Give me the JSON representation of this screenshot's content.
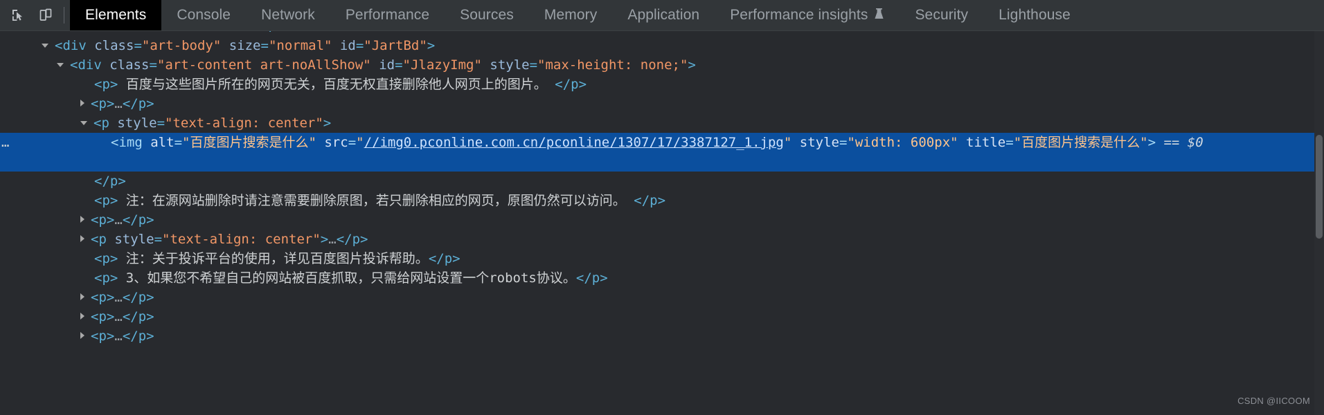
{
  "toolbar": {
    "inspect_icon": "inspect-cursor-icon",
    "device_icon": "device-toolbar-icon",
    "tabs": [
      {
        "label": "Elements",
        "active": true
      },
      {
        "label": "Console",
        "active": false
      },
      {
        "label": "Network",
        "active": false
      },
      {
        "label": "Performance",
        "active": false
      },
      {
        "label": "Sources",
        "active": false
      },
      {
        "label": "Memory",
        "active": false
      },
      {
        "label": "Application",
        "active": false
      },
      {
        "label": "Performance insights",
        "active": false,
        "badge_icon": "flask-icon"
      },
      {
        "label": "Security",
        "active": false
      },
      {
        "label": "Lighthouse",
        "active": false
      }
    ]
  },
  "dom": {
    "clipped_top_row": {
      "text": "<div class=\"art-info\" …></div>"
    },
    "rows": [
      {
        "id": "row-art-body",
        "indent": 80,
        "toggle": "open",
        "parts": [
          {
            "t": "pk",
            "s": "<"
          },
          {
            "t": "tag",
            "s": "div"
          },
          {
            "t": "sp",
            "s": " "
          },
          {
            "t": "att",
            "s": "class"
          },
          {
            "t": "pk",
            "s": "="
          },
          {
            "t": "val",
            "s": "\"art-body\""
          },
          {
            "t": "sp",
            "s": " "
          },
          {
            "t": "att",
            "s": "size"
          },
          {
            "t": "pk",
            "s": "="
          },
          {
            "t": "val",
            "s": "\"normal\""
          },
          {
            "t": "sp",
            "s": " "
          },
          {
            "t": "att",
            "s": "id"
          },
          {
            "t": "pk",
            "s": "="
          },
          {
            "t": "val",
            "s": "\"JartBd\""
          },
          {
            "t": "pk",
            "s": ">"
          }
        ]
      },
      {
        "id": "row-art-content",
        "indent": 102,
        "toggle": "open",
        "parts": [
          {
            "t": "pk",
            "s": "<"
          },
          {
            "t": "tag",
            "s": "div"
          },
          {
            "t": "sp",
            "s": " "
          },
          {
            "t": "att",
            "s": "class"
          },
          {
            "t": "pk",
            "s": "="
          },
          {
            "t": "val",
            "s": "\"art-content art-noAllShow\""
          },
          {
            "t": "sp",
            "s": " "
          },
          {
            "t": "att",
            "s": "id"
          },
          {
            "t": "pk",
            "s": "="
          },
          {
            "t": "val",
            "s": "\"JlazyImg\""
          },
          {
            "t": "sp",
            "s": " "
          },
          {
            "t": "att",
            "s": "style"
          },
          {
            "t": "pk",
            "s": "="
          },
          {
            "t": "val",
            "s": "\"max-height: none;\""
          },
          {
            "t": "pk",
            "s": ">"
          }
        ]
      },
      {
        "id": "row-p-1",
        "indent": 136,
        "toggle": "none",
        "parts": [
          {
            "t": "pk",
            "s": "<"
          },
          {
            "t": "tag",
            "s": "p"
          },
          {
            "t": "pk",
            "s": ">"
          },
          {
            "t": "txt",
            "s": " 百度与这些图片所在的网页无关，百度无权直接删除他人网页上的图片。 "
          },
          {
            "t": "pk",
            "s": "</"
          },
          {
            "t": "tag",
            "s": "p"
          },
          {
            "t": "pk",
            "s": ">"
          }
        ]
      },
      {
        "id": "row-p-2",
        "indent": 136,
        "toggle": "closed",
        "parts": [
          {
            "t": "pk",
            "s": "<"
          },
          {
            "t": "tag",
            "s": "p"
          },
          {
            "t": "pk",
            "s": ">"
          },
          {
            "t": "ellip",
            "s": "…"
          },
          {
            "t": "pk",
            "s": "</"
          },
          {
            "t": "tag",
            "s": "p"
          },
          {
            "t": "pk",
            "s": ">"
          }
        ]
      },
      {
        "id": "row-p-center-open",
        "indent": 136,
        "toggle": "open",
        "parts": [
          {
            "t": "pk",
            "s": "<"
          },
          {
            "t": "tag",
            "s": "p"
          },
          {
            "t": "sp",
            "s": " "
          },
          {
            "t": "att",
            "s": "style"
          },
          {
            "t": "pk",
            "s": "="
          },
          {
            "t": "val",
            "s": "\"text-align: center\""
          },
          {
            "t": "pk",
            "s": ">"
          }
        ]
      },
      {
        "id": "row-img-selected",
        "indent": 160,
        "toggle": "none",
        "selected": true,
        "wrapped": true,
        "gutter": "…",
        "parts": [
          {
            "t": "pk",
            "s": "<"
          },
          {
            "t": "tag",
            "s": "img"
          },
          {
            "t": "sp",
            "s": " "
          },
          {
            "t": "att",
            "s": "alt"
          },
          {
            "t": "pk",
            "s": "="
          },
          {
            "t": "val",
            "s": "\"百度图片搜索是什么\""
          },
          {
            "t": "sp",
            "s": " "
          },
          {
            "t": "att",
            "s": "src"
          },
          {
            "t": "pk",
            "s": "="
          },
          {
            "t": "val",
            "s": "\""
          },
          {
            "t": "lnk",
            "s": "//img0.pconline.com.cn/pconline/1307/17/3387127_1.jpg"
          },
          {
            "t": "val",
            "s": "\""
          },
          {
            "t": "sp",
            "s": " "
          },
          {
            "t": "att",
            "s": "style"
          },
          {
            "t": "pk",
            "s": "="
          },
          {
            "t": "val",
            "s": "\"width: 600px\""
          },
          {
            "t": "sp",
            "s": " "
          },
          {
            "t": "att",
            "s": "title"
          },
          {
            "t": "pk",
            "s": "="
          },
          {
            "t": "val",
            "s": "\"百度图片搜索是什么\""
          },
          {
            "t": "pk",
            "s": ">"
          },
          {
            "t": "sp",
            "s": " "
          },
          {
            "t": "dollar",
            "s": "== $0"
          }
        ]
      },
      {
        "id": "row-p-center-close",
        "indent": 136,
        "toggle": "none",
        "parts": [
          {
            "t": "pk",
            "s": "</"
          },
          {
            "t": "tag",
            "s": "p"
          },
          {
            "t": "pk",
            "s": ">"
          }
        ]
      },
      {
        "id": "row-p-3",
        "indent": 136,
        "toggle": "none",
        "parts": [
          {
            "t": "pk",
            "s": "<"
          },
          {
            "t": "tag",
            "s": "p"
          },
          {
            "t": "pk",
            "s": ">"
          },
          {
            "t": "txt",
            "s": " 注：在源网站删除时请注意需要删除原图，若只删除相应的网页，原图仍然可以访问。 "
          },
          {
            "t": "pk",
            "s": "</"
          },
          {
            "t": "tag",
            "s": "p"
          },
          {
            "t": "pk",
            "s": ">"
          }
        ]
      },
      {
        "id": "row-p-4",
        "indent": 136,
        "toggle": "closed",
        "parts": [
          {
            "t": "pk",
            "s": "<"
          },
          {
            "t": "tag",
            "s": "p"
          },
          {
            "t": "pk",
            "s": ">"
          },
          {
            "t": "ellip",
            "s": "…"
          },
          {
            "t": "pk",
            "s": "</"
          },
          {
            "t": "tag",
            "s": "p"
          },
          {
            "t": "pk",
            "s": ">"
          }
        ]
      },
      {
        "id": "row-p-center-collapsed",
        "indent": 136,
        "toggle": "closed",
        "parts": [
          {
            "t": "pk",
            "s": "<"
          },
          {
            "t": "tag",
            "s": "p"
          },
          {
            "t": "sp",
            "s": " "
          },
          {
            "t": "att",
            "s": "style"
          },
          {
            "t": "pk",
            "s": "="
          },
          {
            "t": "val",
            "s": "\"text-align: center\""
          },
          {
            "t": "pk",
            "s": ">"
          },
          {
            "t": "ellip",
            "s": "…"
          },
          {
            "t": "pk",
            "s": "</"
          },
          {
            "t": "tag",
            "s": "p"
          },
          {
            "t": "pk",
            "s": ">"
          }
        ]
      },
      {
        "id": "row-p-5",
        "indent": 136,
        "toggle": "none",
        "parts": [
          {
            "t": "pk",
            "s": "<"
          },
          {
            "t": "tag",
            "s": "p"
          },
          {
            "t": "pk",
            "s": ">"
          },
          {
            "t": "txt",
            "s": " 注：关于投诉平台的使用，详见百度图片投诉帮助。"
          },
          {
            "t": "pk",
            "s": "</"
          },
          {
            "t": "tag",
            "s": "p"
          },
          {
            "t": "pk",
            "s": ">"
          }
        ]
      },
      {
        "id": "row-p-6",
        "indent": 136,
        "toggle": "none",
        "parts": [
          {
            "t": "pk",
            "s": "<"
          },
          {
            "t": "tag",
            "s": "p"
          },
          {
            "t": "pk",
            "s": ">"
          },
          {
            "t": "txt",
            "s": " 3、如果您不希望自己的网站被百度抓取，只需给网站设置一个robots协议。"
          },
          {
            "t": "pk",
            "s": "</"
          },
          {
            "t": "tag",
            "s": "p"
          },
          {
            "t": "pk",
            "s": ">"
          }
        ]
      },
      {
        "id": "row-p-7",
        "indent": 136,
        "toggle": "closed",
        "parts": [
          {
            "t": "pk",
            "s": "<"
          },
          {
            "t": "tag",
            "s": "p"
          },
          {
            "t": "pk",
            "s": ">"
          },
          {
            "t": "ellip",
            "s": "…"
          },
          {
            "t": "pk",
            "s": "</"
          },
          {
            "t": "tag",
            "s": "p"
          },
          {
            "t": "pk",
            "s": ">"
          }
        ]
      },
      {
        "id": "row-p-8",
        "indent": 136,
        "toggle": "closed",
        "parts": [
          {
            "t": "pk",
            "s": "<"
          },
          {
            "t": "tag",
            "s": "p"
          },
          {
            "t": "pk",
            "s": ">"
          },
          {
            "t": "ellip",
            "s": "…"
          },
          {
            "t": "pk",
            "s": "</"
          },
          {
            "t": "tag",
            "s": "p"
          },
          {
            "t": "pk",
            "s": ">"
          }
        ]
      },
      {
        "id": "row-p-9",
        "indent": 136,
        "toggle": "closed",
        "clipped_bottom": true,
        "parts": [
          {
            "t": "pk",
            "s": "<"
          },
          {
            "t": "tag",
            "s": "p"
          },
          {
            "t": "pk",
            "s": ">"
          },
          {
            "t": "ellip",
            "s": "…"
          },
          {
            "t": "pk",
            "s": "</"
          },
          {
            "t": "tag",
            "s": "p"
          },
          {
            "t": "pk",
            "s": ">"
          }
        ]
      }
    ]
  },
  "scrollbar": {
    "name": "vertical-scrollbar"
  },
  "watermark": {
    "text": "CSDN @IICOOM"
  },
  "colors": {
    "toolbar_bg": "#323639",
    "panel_bg": "#282a2e",
    "active_tab_bg": "#000000",
    "selection_bg": "#0b4f9e",
    "tag": "#5db0d7",
    "attr_name": "#9bbbdc",
    "attr_value": "#f29766",
    "text_node": "#cfd2d4",
    "link": "#8ab4f8"
  }
}
